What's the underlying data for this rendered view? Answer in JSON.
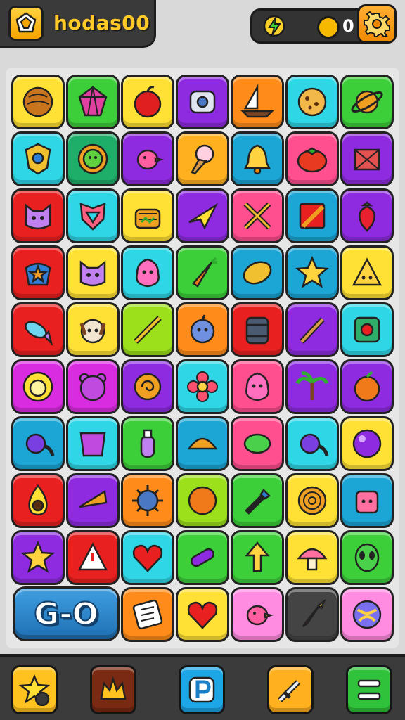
{
  "header": {
    "title": "hodas00",
    "coin_count": "0"
  },
  "board": {
    "go_label": "G-O",
    "tiles": [
      {
        "color": "#ffe135",
        "icon": "coconut-icon"
      },
      {
        "color": "#3ccf3a",
        "icon": "gem-icon"
      },
      {
        "color": "#ffe135",
        "icon": "apple-icon"
      },
      {
        "color": "#8e2be0",
        "icon": "robot-head-icon"
      },
      {
        "color": "#ff8c1a",
        "icon": "sailboat-icon"
      },
      {
        "color": "#2fd6e6",
        "icon": "cookie-icon"
      },
      {
        "color": "#3ccf3a",
        "icon": "planet-icon"
      },
      {
        "color": "#2fd6e6",
        "icon": "crest-icon"
      },
      {
        "color": "#1fae6a",
        "icon": "sun-face-icon"
      },
      {
        "color": "#8e2be0",
        "icon": "bird-icon"
      },
      {
        "color": "#ffb01f",
        "icon": "ice-cream-icon"
      },
      {
        "color": "#1ca6d6",
        "icon": "bell-icon"
      },
      {
        "color": "#ff4f8e",
        "icon": "tomato-icon"
      },
      {
        "color": "#8e2be0",
        "icon": "crate-icon"
      },
      {
        "color": "#e82020",
        "icon": "cat-face-icon"
      },
      {
        "color": "#2fd6e6",
        "icon": "shield-icon"
      },
      {
        "color": "#ffe135",
        "icon": "basket-icon"
      },
      {
        "color": "#8e2be0",
        "icon": "paper-plane-icon"
      },
      {
        "color": "#ff4f8e",
        "icon": "crossed-swords-icon"
      },
      {
        "color": "#1ca6d6",
        "icon": "pencil-box-icon"
      },
      {
        "color": "#8e2be0",
        "icon": "strawberry-icon"
      },
      {
        "color": "#e82020",
        "icon": "star-bag-icon"
      },
      {
        "color": "#ffe135",
        "icon": "cat-face-icon"
      },
      {
        "color": "#2fd6e6",
        "icon": "blob-icon"
      },
      {
        "color": "#3ccf3a",
        "icon": "carrot-icon"
      },
      {
        "color": "#1ca6d6",
        "icon": "lemon-icon"
      },
      {
        "color": "#1ca6d6",
        "icon": "star-icon"
      },
      {
        "color": "#ffe135",
        "icon": "triangle-face-icon"
      },
      {
        "color": "#e82020",
        "icon": "fish-icon"
      },
      {
        "color": "#ffe135",
        "icon": "dog-face-icon"
      },
      {
        "color": "#9be01a",
        "icon": "stick-icon"
      },
      {
        "color": "#ff8c1a",
        "icon": "bomb-icon"
      },
      {
        "color": "#e82020",
        "icon": "barrel-icon"
      },
      {
        "color": "#8e2be0",
        "icon": "wand-icon"
      },
      {
        "color": "#2fd6e6",
        "icon": "chip-icon"
      },
      {
        "color": "#d92be0",
        "icon": "lion-face-icon"
      },
      {
        "color": "#d92be0",
        "icon": "bear-face-icon"
      },
      {
        "color": "#8e2be0",
        "icon": "swirl-icon"
      },
      {
        "color": "#2fd6e6",
        "icon": "flower-icon"
      },
      {
        "color": "#ff4f8e",
        "icon": "blob-icon"
      },
      {
        "color": "#8e2be0",
        "icon": "palm-icon"
      },
      {
        "color": "#8e2be0",
        "icon": "orange-fruit-icon"
      },
      {
        "color": "#1ca6d6",
        "icon": "tadpole-icon"
      },
      {
        "color": "#2fd6e6",
        "icon": "cup-icon"
      },
      {
        "color": "#3ccf3a",
        "icon": "bottle-icon"
      },
      {
        "color": "#1ca6d6",
        "icon": "shell-icon"
      },
      {
        "color": "#ff4f8e",
        "icon": "pea-icon"
      },
      {
        "color": "#2fd6e6",
        "icon": "tadpole-icon"
      },
      {
        "color": "#ffe135",
        "icon": "orb-icon"
      },
      {
        "color": "#e82020",
        "icon": "avocado-icon"
      },
      {
        "color": "#8e2be0",
        "icon": "horn-icon"
      },
      {
        "color": "#ff8c1a",
        "icon": "spiky-ball-icon"
      },
      {
        "color": "#9be01a",
        "icon": "orange-icon"
      },
      {
        "color": "#3ccf3a",
        "icon": "brush-icon"
      },
      {
        "color": "#ffe135",
        "icon": "spiral-candy-icon"
      },
      {
        "color": "#1ca6d6",
        "icon": "jar-face-icon"
      },
      {
        "color": "#8e2be0",
        "icon": "star-icon"
      },
      {
        "color": "#e82020",
        "icon": "warning-triangle-icon"
      },
      {
        "color": "#2fd6e6",
        "icon": "heart-icon"
      },
      {
        "color": "#3ccf3a",
        "icon": "capsule-icon"
      },
      {
        "color": "#3ccf3a",
        "icon": "arrow-up-icon"
      },
      {
        "color": "#ffe135",
        "icon": "mushroom-icon"
      },
      {
        "color": "#3ccf3a",
        "icon": "alien-face-icon"
      },
      {
        "color": "#ff8c1a",
        "icon": "book-icon"
      },
      {
        "color": "#ffe135",
        "icon": "heart-icon"
      },
      {
        "color": "#ff8ce0",
        "icon": "bird-icon"
      },
      {
        "color": "#444444",
        "icon": "rocket-icon"
      },
      {
        "color": "#ff8ce0",
        "icon": "marble-ball-icon"
      }
    ]
  },
  "bottom_bar": {
    "buttons": [
      {
        "icon": "star-coin-icon",
        "color": "#ffc21f"
      },
      {
        "icon": "crown-icon",
        "color": "#7a2a12"
      },
      {
        "icon": "p-icon",
        "color": "#1ca6e6"
      },
      {
        "icon": "sword-icon",
        "color": "#ffb01f"
      },
      {
        "icon": "menu-icon",
        "color": "#2fc23a"
      }
    ]
  }
}
